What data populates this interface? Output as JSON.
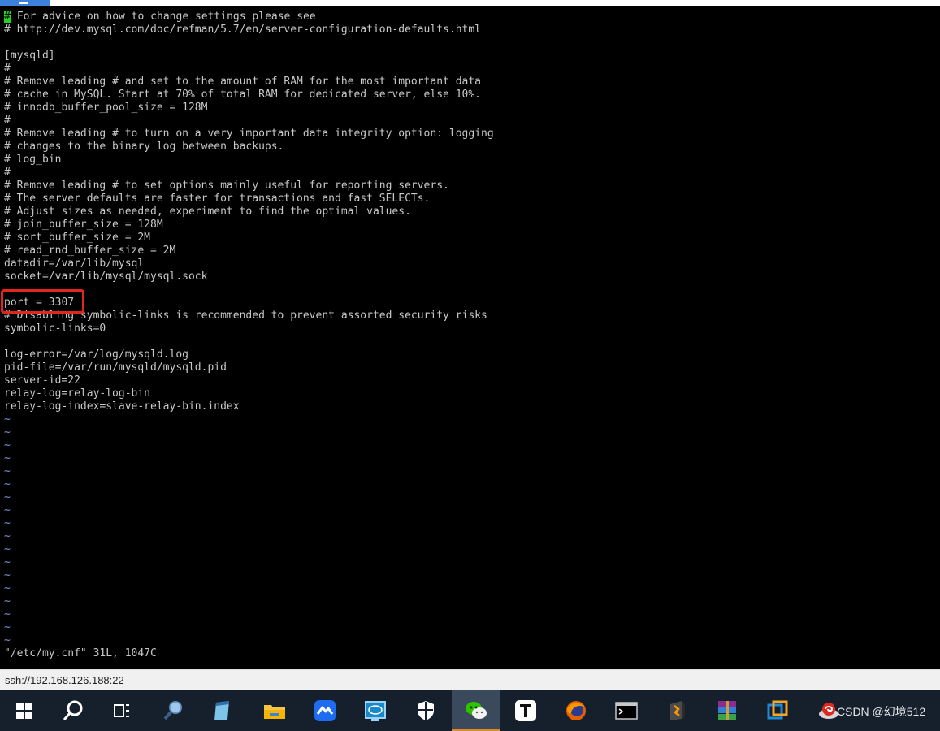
{
  "terminal": {
    "cursor_char": "#",
    "first_line_rest": " For advice on how to change settings please see",
    "lines": [
      "# http://dev.mysql.com/doc/refman/5.7/en/server-configuration-defaults.html",
      "",
      "[mysqld]",
      "#",
      "# Remove leading # and set to the amount of RAM for the most important data",
      "# cache in MySQL. Start at 70% of total RAM for dedicated server, else 10%.",
      "# innodb_buffer_pool_size = 128M",
      "#",
      "# Remove leading # to turn on a very important data integrity option: logging",
      "# changes to the binary log between backups.",
      "# log_bin",
      "#",
      "# Remove leading # to set options mainly useful for reporting servers.",
      "# The server defaults are faster for transactions and fast SELECTs.",
      "# Adjust sizes as needed, experiment to find the optimal values.",
      "# join_buffer_size = 128M",
      "# sort_buffer_size = 2M",
      "# read_rnd_buffer_size = 2M",
      "datadir=/var/lib/mysql",
      "socket=/var/lib/mysql/mysql.sock",
      "",
      "port = 3307",
      "# Disabling symbolic-links is recommended to prevent assorted security risks",
      "symbolic-links=0",
      "",
      "log-error=/var/log/mysqld.log",
      "pid-file=/var/run/mysqld/mysqld.pid",
      "server-id=22",
      "relay-log=relay-log-bin",
      "relay-log-index=slave-relay-bin.index"
    ],
    "tilde": "~",
    "tilde_count": 18,
    "file_status": "\"/etc/my.cnf\" 31L, 1047C"
  },
  "status_bar": {
    "connection": "ssh://192.168.126.188:22"
  },
  "taskbar": {
    "items": [
      {
        "icon": "windows-start-icon",
        "active": false
      },
      {
        "icon": "search-icon",
        "active": false
      },
      {
        "icon": "task-view-icon",
        "active": false
      },
      {
        "icon": "magnifier-app-icon",
        "active": false
      },
      {
        "icon": "notepad-icon",
        "active": false
      },
      {
        "icon": "file-explorer-icon",
        "active": false
      },
      {
        "icon": "tencent-meeting-icon",
        "active": false
      },
      {
        "icon": "intel-graphics-icon",
        "active": false
      },
      {
        "icon": "security-shield-icon",
        "active": false
      },
      {
        "icon": "wechat-icon",
        "active": true
      },
      {
        "icon": "typora-icon",
        "active": false
      },
      {
        "icon": "firefox-icon",
        "active": false
      },
      {
        "icon": "terminal-icon",
        "active": false
      },
      {
        "icon": "sublime-text-icon",
        "active": false
      },
      {
        "icon": "winrar-icon",
        "active": false
      },
      {
        "icon": "virtualbox-icon",
        "active": false
      },
      {
        "icon": "xshell-icon",
        "active": false
      }
    ]
  },
  "watermark": "CSDN @幻境512",
  "colors": {
    "terminal_bg": "#000000",
    "terminal_fg": "#c8c8c8",
    "cursor": "#23d523",
    "highlight_border": "#e0261d",
    "status_bg": "#f0f0f0",
    "taskbar_bg": "#16202c",
    "taskbar_active": "#3a4a5c"
  }
}
